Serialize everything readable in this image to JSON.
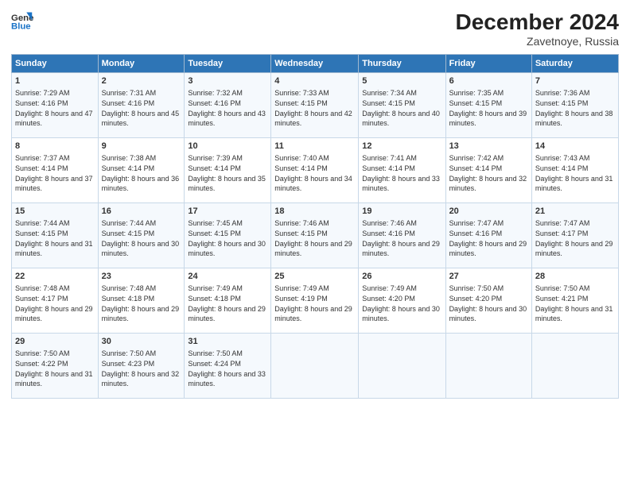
{
  "header": {
    "logo_line1": "General",
    "logo_line2": "Blue",
    "month_title": "December 2024",
    "location": "Zavetnoye, Russia"
  },
  "days_of_week": [
    "Sunday",
    "Monday",
    "Tuesday",
    "Wednesday",
    "Thursday",
    "Friday",
    "Saturday"
  ],
  "weeks": [
    [
      {
        "day": 1,
        "sunrise": "7:29 AM",
        "sunset": "4:16 PM",
        "daylight": "8 hours and 47 minutes."
      },
      {
        "day": 2,
        "sunrise": "7:31 AM",
        "sunset": "4:16 PM",
        "daylight": "8 hours and 45 minutes."
      },
      {
        "day": 3,
        "sunrise": "7:32 AM",
        "sunset": "4:16 PM",
        "daylight": "8 hours and 43 minutes."
      },
      {
        "day": 4,
        "sunrise": "7:33 AM",
        "sunset": "4:15 PM",
        "daylight": "8 hours and 42 minutes."
      },
      {
        "day": 5,
        "sunrise": "7:34 AM",
        "sunset": "4:15 PM",
        "daylight": "8 hours and 40 minutes."
      },
      {
        "day": 6,
        "sunrise": "7:35 AM",
        "sunset": "4:15 PM",
        "daylight": "8 hours and 39 minutes."
      },
      {
        "day": 7,
        "sunrise": "7:36 AM",
        "sunset": "4:15 PM",
        "daylight": "8 hours and 38 minutes."
      }
    ],
    [
      {
        "day": 8,
        "sunrise": "7:37 AM",
        "sunset": "4:14 PM",
        "daylight": "8 hours and 37 minutes."
      },
      {
        "day": 9,
        "sunrise": "7:38 AM",
        "sunset": "4:14 PM",
        "daylight": "8 hours and 36 minutes."
      },
      {
        "day": 10,
        "sunrise": "7:39 AM",
        "sunset": "4:14 PM",
        "daylight": "8 hours and 35 minutes."
      },
      {
        "day": 11,
        "sunrise": "7:40 AM",
        "sunset": "4:14 PM",
        "daylight": "8 hours and 34 minutes."
      },
      {
        "day": 12,
        "sunrise": "7:41 AM",
        "sunset": "4:14 PM",
        "daylight": "8 hours and 33 minutes."
      },
      {
        "day": 13,
        "sunrise": "7:42 AM",
        "sunset": "4:14 PM",
        "daylight": "8 hours and 32 minutes."
      },
      {
        "day": 14,
        "sunrise": "7:43 AM",
        "sunset": "4:14 PM",
        "daylight": "8 hours and 31 minutes."
      }
    ],
    [
      {
        "day": 15,
        "sunrise": "7:44 AM",
        "sunset": "4:15 PM",
        "daylight": "8 hours and 31 minutes."
      },
      {
        "day": 16,
        "sunrise": "7:44 AM",
        "sunset": "4:15 PM",
        "daylight": "8 hours and 30 minutes."
      },
      {
        "day": 17,
        "sunrise": "7:45 AM",
        "sunset": "4:15 PM",
        "daylight": "8 hours and 30 minutes."
      },
      {
        "day": 18,
        "sunrise": "7:46 AM",
        "sunset": "4:15 PM",
        "daylight": "8 hours and 29 minutes."
      },
      {
        "day": 19,
        "sunrise": "7:46 AM",
        "sunset": "4:16 PM",
        "daylight": "8 hours and 29 minutes."
      },
      {
        "day": 20,
        "sunrise": "7:47 AM",
        "sunset": "4:16 PM",
        "daylight": "8 hours and 29 minutes."
      },
      {
        "day": 21,
        "sunrise": "7:47 AM",
        "sunset": "4:17 PM",
        "daylight": "8 hours and 29 minutes."
      }
    ],
    [
      {
        "day": 22,
        "sunrise": "7:48 AM",
        "sunset": "4:17 PM",
        "daylight": "8 hours and 29 minutes."
      },
      {
        "day": 23,
        "sunrise": "7:48 AM",
        "sunset": "4:18 PM",
        "daylight": "8 hours and 29 minutes."
      },
      {
        "day": 24,
        "sunrise": "7:49 AM",
        "sunset": "4:18 PM",
        "daylight": "8 hours and 29 minutes."
      },
      {
        "day": 25,
        "sunrise": "7:49 AM",
        "sunset": "4:19 PM",
        "daylight": "8 hours and 29 minutes."
      },
      {
        "day": 26,
        "sunrise": "7:49 AM",
        "sunset": "4:20 PM",
        "daylight": "8 hours and 30 minutes."
      },
      {
        "day": 27,
        "sunrise": "7:50 AM",
        "sunset": "4:20 PM",
        "daylight": "8 hours and 30 minutes."
      },
      {
        "day": 28,
        "sunrise": "7:50 AM",
        "sunset": "4:21 PM",
        "daylight": "8 hours and 31 minutes."
      }
    ],
    [
      {
        "day": 29,
        "sunrise": "7:50 AM",
        "sunset": "4:22 PM",
        "daylight": "8 hours and 31 minutes."
      },
      {
        "day": 30,
        "sunrise": "7:50 AM",
        "sunset": "4:23 PM",
        "daylight": "8 hours and 32 minutes."
      },
      {
        "day": 31,
        "sunrise": "7:50 AM",
        "sunset": "4:24 PM",
        "daylight": "8 hours and 33 minutes."
      },
      null,
      null,
      null,
      null
    ]
  ]
}
